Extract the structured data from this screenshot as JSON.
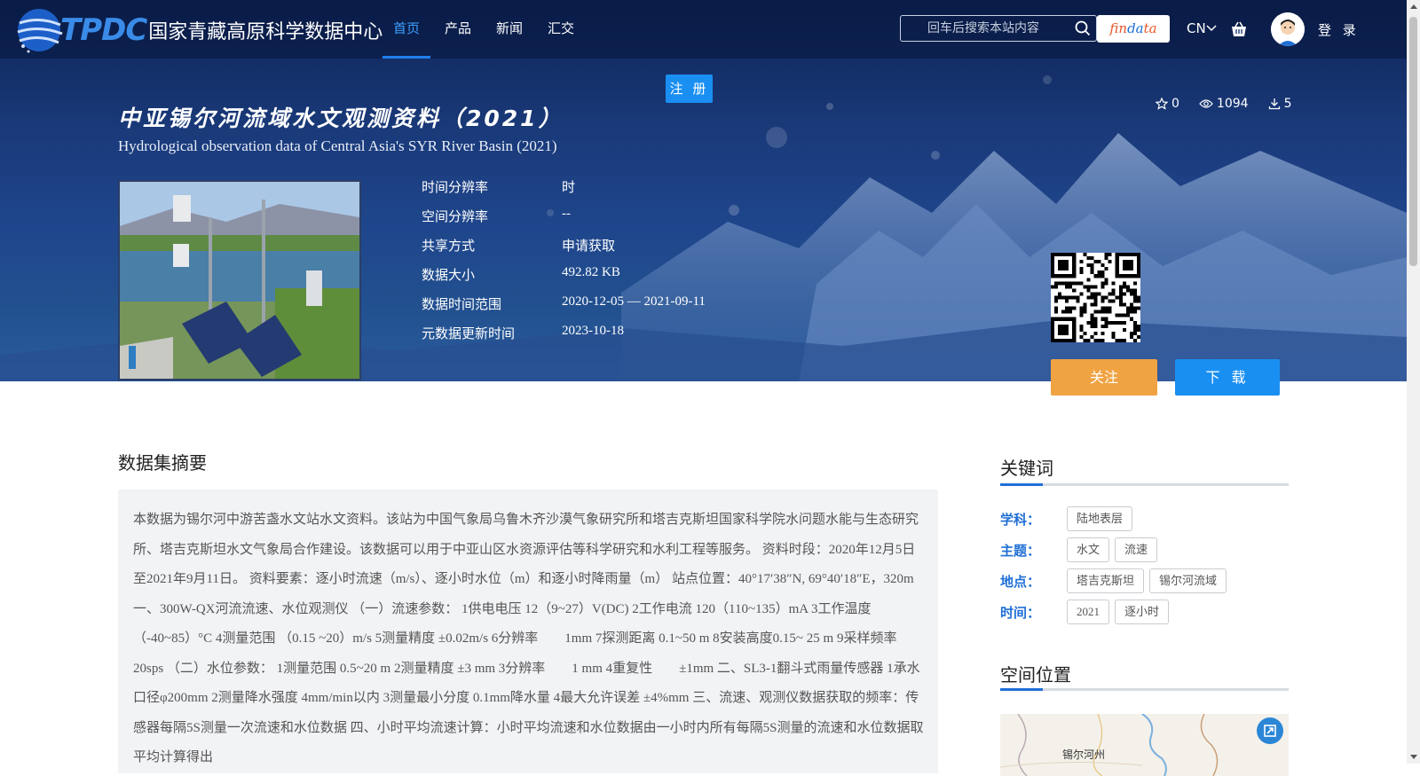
{
  "header": {
    "logo_text": "TPDC",
    "logo_subtitle": "国家青藏高原科学数据中心",
    "nav": [
      {
        "label": "首页",
        "active": true
      },
      {
        "label": "产品"
      },
      {
        "label": "新闻"
      },
      {
        "label": "汇交"
      }
    ],
    "search_placeholder": "回车后搜索本站内容",
    "findata": {
      "part1": "fin",
      "part2": "da",
      "part3": "ta"
    },
    "lang": "CN",
    "login": "登 录"
  },
  "hero": {
    "register": "注 册",
    "title_cn": "中亚锡尔河流域水文观测资料（2021）",
    "title_en": "Hydrological observation data of Central Asia's SYR River Basin (2021)",
    "stats": {
      "favorites": "0",
      "views": "1094",
      "downloads": "5"
    },
    "info": [
      {
        "label": "时间分辨率",
        "value": "时"
      },
      {
        "label": "空间分辨率",
        "value": "--"
      },
      {
        "label": "共享方式",
        "value": "申请获取"
      },
      {
        "label": "数据大小",
        "value": "492.82 KB"
      },
      {
        "label": "数据时间范围",
        "value": "2020-12-05 — 2021-09-11"
      },
      {
        "label": "元数据更新时间",
        "value": "2023-10-18"
      }
    ],
    "follow_button": "关注",
    "download_button": "下 载"
  },
  "abstract": {
    "title": "数据集摘要",
    "text": "本数据为锡尔河中游苦盏水文站水文资料。该站为中国气象局乌鲁木齐沙漠气象研究所和塔吉克斯坦国家科学院水问题水能与生态研究所、塔吉克斯坦水文气象局合作建设。该数据可以用于中亚山区水资源评估等科学研究和水利工程等服务。 资料时段：2020年12月5日至2021年9月11日。 资料要素：逐小时流速（m/s）、逐小时水位（m）和逐小时降雨量（m） 站点位置：40°17′38″N, 69°40′18″E，320m 一、300W-QX河流流速、水位观测仪 （一）流速参数： 1供电电压 12（9~27）V(DC) 2工作电流 120（110~135）mA 3工作温度（-40~85）°C 4测量范围 （0.15 ~20）m/s 5测量精度 ±0.02m/s 6分辨率　　1mm 7探测距离 0.1~50 m 8安装高度0.15~ 25 m 9采样频率　　20sps （二）水位参数： 1测量范围 0.5~20 m 2测量精度 ±3 mm 3分辨率　　1 mm 4重复性　　±1mm 二、SL3-1翻斗式雨量传感器 1承水口径φ200mm 2测量降水强度 4mm/min以内 3测量最小分度 0.1mm降水量 4最大允许误差 ±4%mm 三、流速、观测仪数据获取的频率：传感器每隔5S测量一次流速和水位数据 四、小时平均流速计算：小时平均流速和水位数据由一小时内所有每隔5S测量的流速和水位数据取平均计算得出"
  },
  "keywords": {
    "title": "关键词",
    "rows": [
      {
        "label": "学科：",
        "tags": [
          "陆地表层"
        ]
      },
      {
        "label": "主题：",
        "tags": [
          "水文",
          "流速"
        ]
      },
      {
        "label": "地点：",
        "tags": [
          "塔吉克斯坦",
          "锡尔河流域"
        ]
      },
      {
        "label": "时间：",
        "tags": [
          "2021",
          "逐小时"
        ]
      }
    ]
  },
  "location": {
    "title": "空间位置",
    "map_label": "锡尔河州"
  },
  "colors": {
    "accent_blue": "#1a8ff2",
    "follow_orange": "#f0a343",
    "keyword_label": "#1f6fd6"
  }
}
